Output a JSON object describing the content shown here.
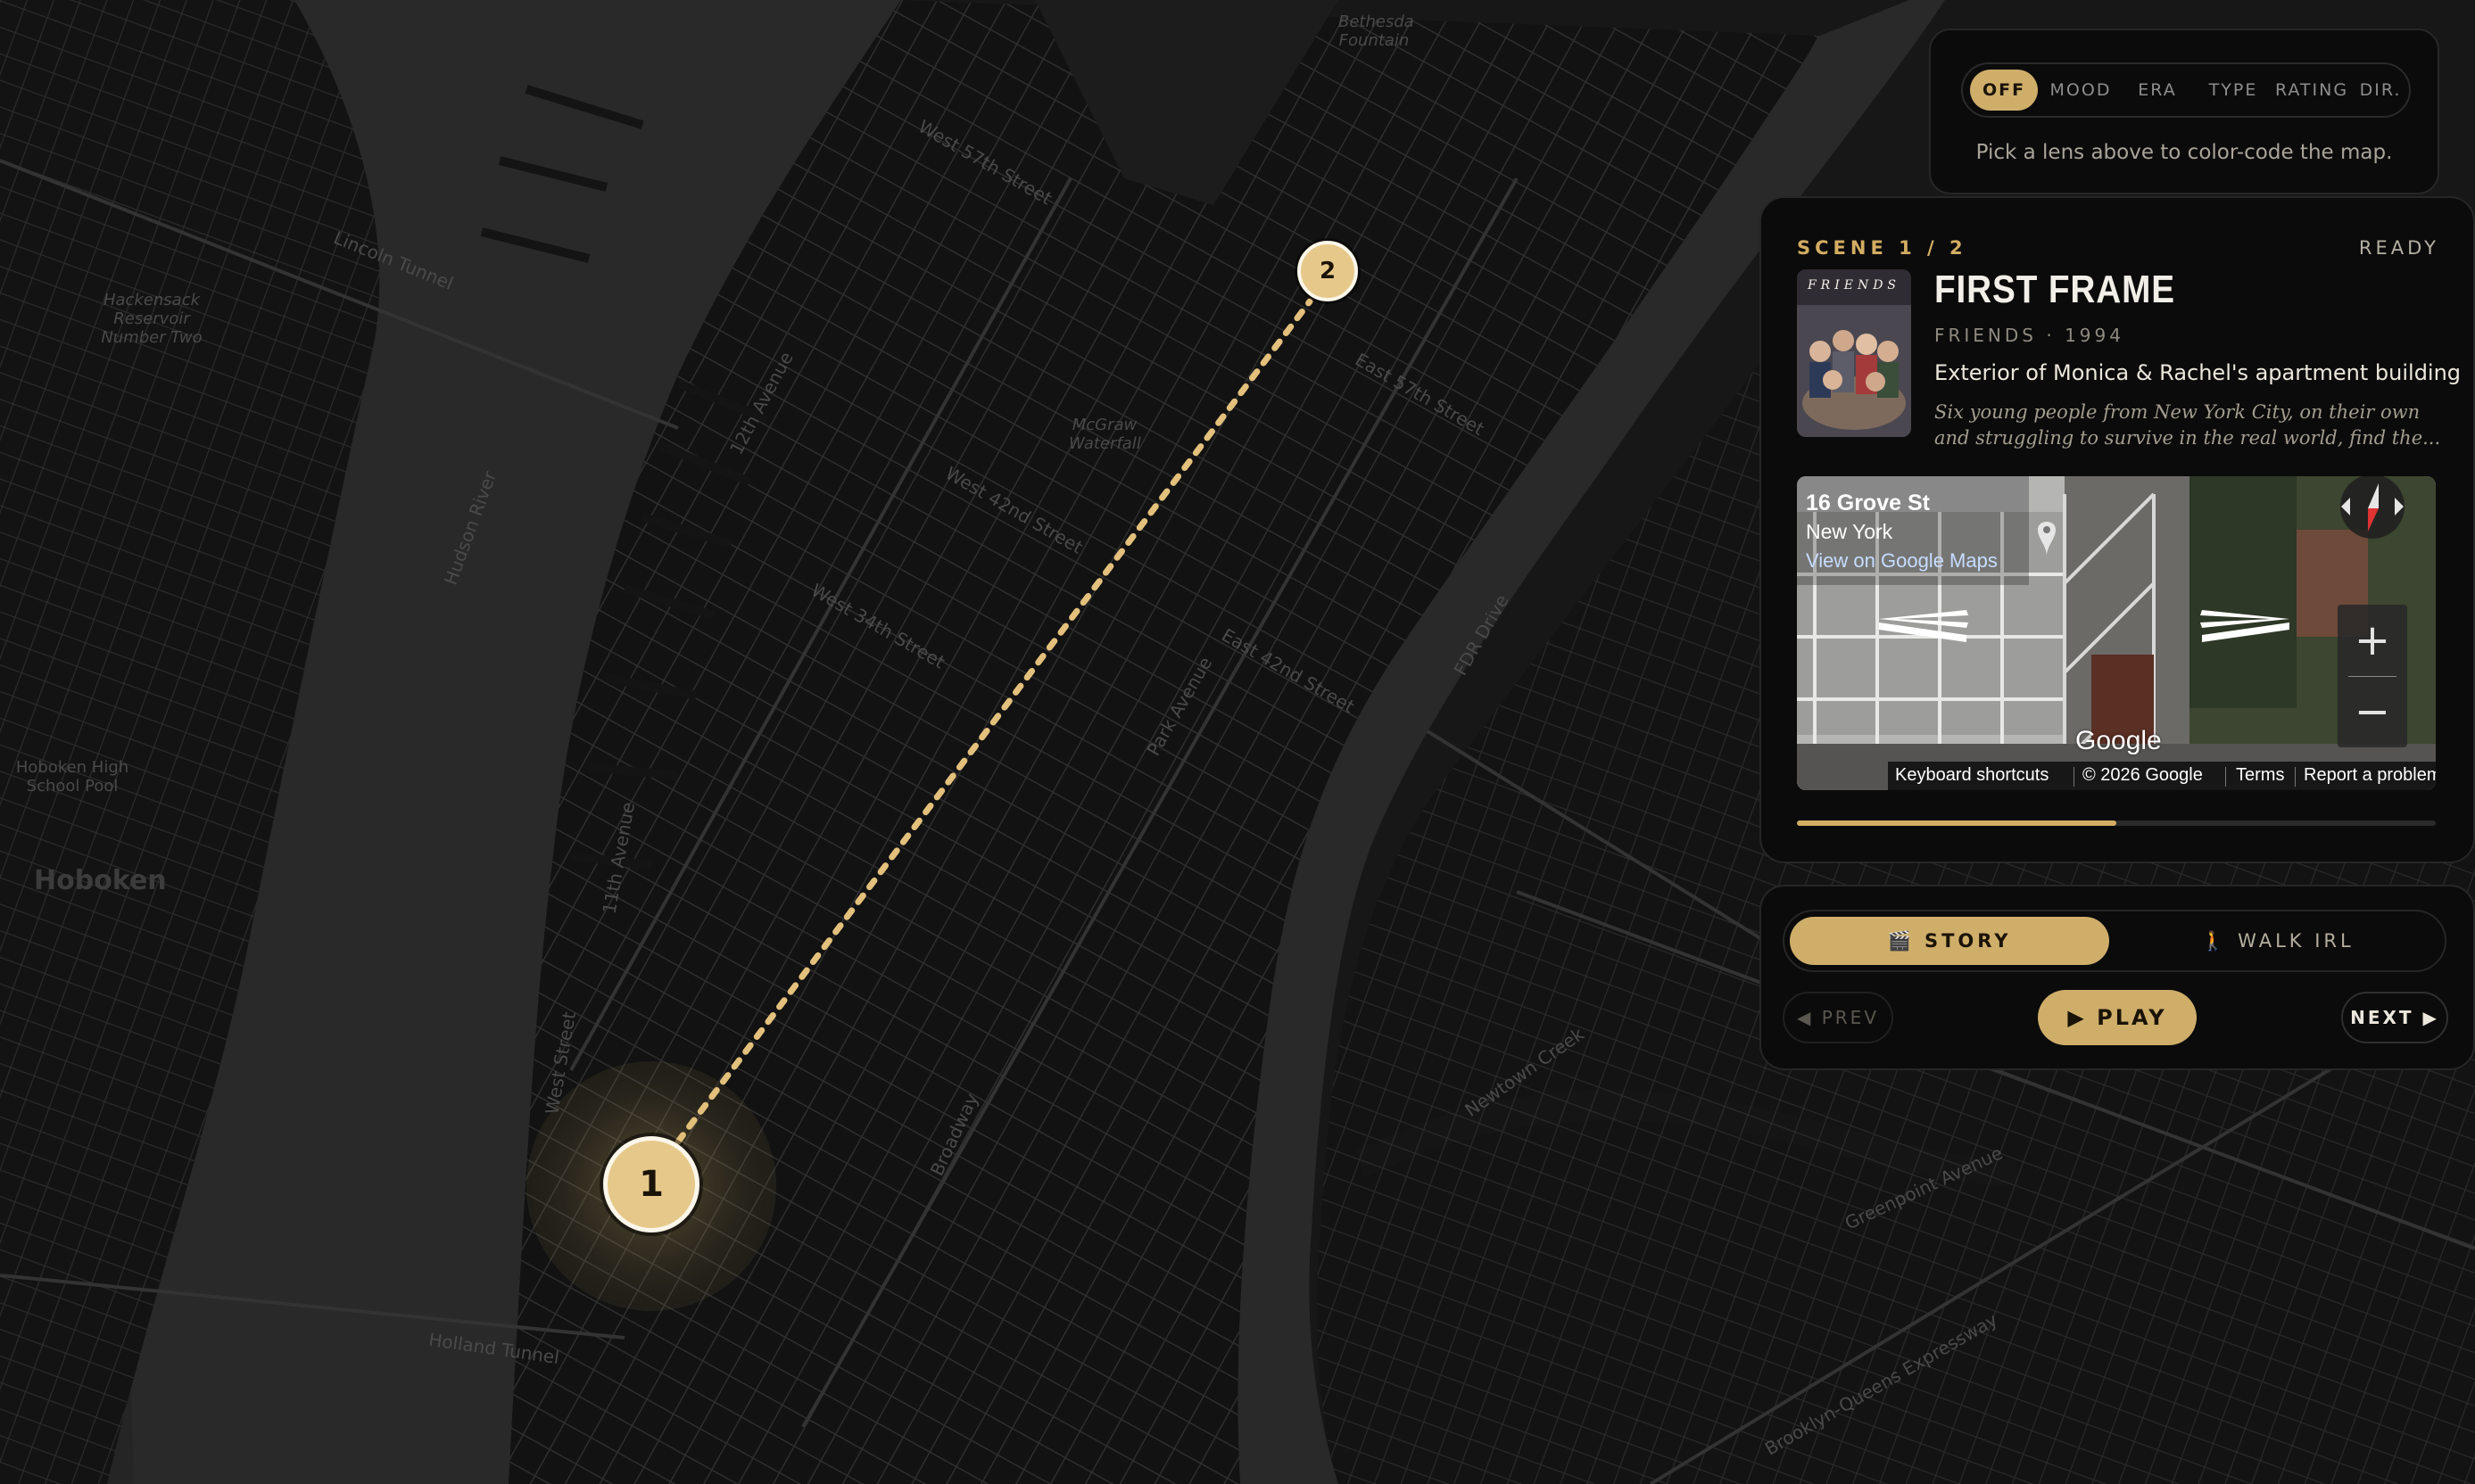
{
  "map": {
    "area_labels": [
      "Hoboken",
      "Hoboken High School Pool",
      "Hackensack Reservoir Number Two",
      "Bethesda Fountain",
      "McGraw Waterfall"
    ],
    "road_labels": [
      "Lincoln Tunnel",
      "Holland Tunnel",
      "West Street",
      "West 57th Street",
      "West 42nd Street",
      "West 34th Street",
      "East 57th Street",
      "East 42nd Street",
      "Park Avenue",
      "FDR Drive",
      "Broadway",
      "12th Avenue",
      "11th Avenue",
      "Hudson River",
      "Newtown Creek",
      "Brooklyn-Queens Expressway",
      "Greenpoint Avenue"
    ],
    "markers": [
      {
        "label": "1",
        "status": "active"
      },
      {
        "label": "2",
        "status": "upcoming"
      }
    ]
  },
  "lens": {
    "tabs": [
      {
        "label": "OFF",
        "active": true
      },
      {
        "label": "MOOD",
        "active": false
      },
      {
        "label": "ERA",
        "active": false
      },
      {
        "label": "TYPE",
        "active": false
      },
      {
        "label": "RATING",
        "active": false
      },
      {
        "label": "DIR.",
        "active": false
      }
    ],
    "hint": "Pick a lens above to color-code the map."
  },
  "scene": {
    "counter": "SCENE 1 / 2",
    "status": "READY",
    "poster_title": "FRIENDS",
    "title": "FIRST FRAME",
    "meta": "FRIENDS · 1994",
    "description": "Exterior of Monica & Rachel's apartment building",
    "synopsis": "Six young people from New York City, on their own and struggling to survive in the real world, find the...",
    "progress": 0.5
  },
  "streetview": {
    "street": "16 Grove St",
    "city": "New York",
    "link": "View on Google Maps",
    "zoom_in": "+",
    "zoom_out": "−",
    "logo": "Google",
    "footer": [
      "Keyboard shortcuts",
      "© 2026 Google",
      "Terms",
      "Report a problem"
    ]
  },
  "controls": {
    "story_label": "🎬 STORY",
    "walk_label": "🚶 WALK IRL",
    "prev_label": "◀ PREV",
    "play_label": "▶ PLAY",
    "next_label": "NEXT ▶"
  },
  "colors": {
    "accent": "#cfae6a",
    "background": "#0b0b0b",
    "map_base": "#161616",
    "water": "#262626"
  }
}
